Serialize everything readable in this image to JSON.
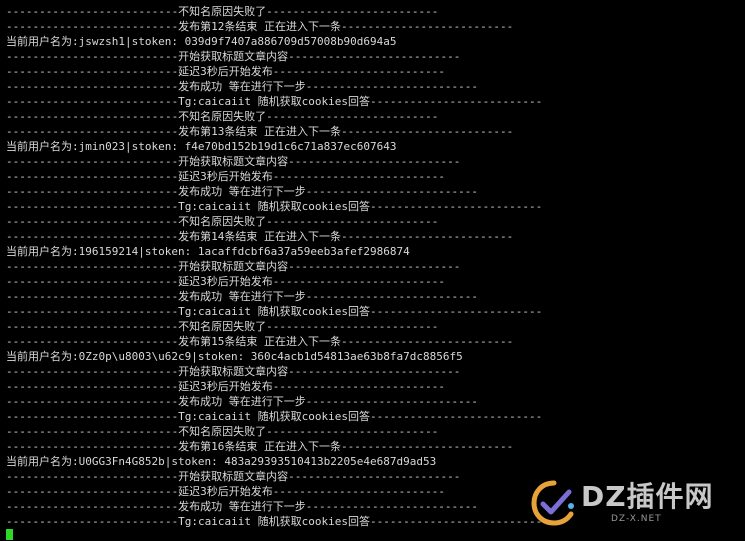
{
  "terminal": {
    "lines": [
      "--------------------------不知名原因失败了--------------------------",
      "--------------------------发布第12条结束 正在进入下一条--------------------------",
      "当前用户名为:jswzsh1|stoken: 039d9f7407a886709d57008b90d694a5",
      "--------------------------开始获取标题文章内容--------------------------",
      "--------------------------延迟3秒后开始发布--------------------------",
      "--------------------------发布成功 等在进行下一步--------------------------",
      "--------------------------Tg:caicaiit 随机获取cookies回答--------------------------",
      "--------------------------不知名原因失败了--------------------------",
      "--------------------------发布第13条结束 正在进入下一条--------------------------",
      "当前用户名为:jmin023|stoken: f4e70bd152b19d1c6c71a837ec607643",
      "--------------------------开始获取标题文章内容--------------------------",
      "--------------------------延迟3秒后开始发布--------------------------",
      "--------------------------发布成功 等在进行下一步--------------------------",
      "--------------------------Tg:caicaiit 随机获取cookies回答--------------------------",
      "--------------------------不知名原因失败了--------------------------",
      "--------------------------发布第14条结束 正在进入下一条--------------------------",
      "当前用户名为:196159214|stoken: 1acaffdcbf6a37a59eeb3afef2986874",
      "--------------------------开始获取标题文章内容--------------------------",
      "--------------------------延迟3秒后开始发布--------------------------",
      "--------------------------发布成功 等在进行下一步--------------------------",
      "--------------------------Tg:caicaiit 随机获取cookies回答--------------------------",
      "--------------------------不知名原因失败了--------------------------",
      "--------------------------发布第15条结束 正在进入下一条--------------------------",
      "当前用户名为:0Zz0p\\u8003\\u62c9|stoken: 360c4acb1d54813ae63b8fa7dc8856f5",
      "--------------------------开始获取标题文章内容--------------------------",
      "--------------------------延迟3秒后开始发布--------------------------",
      "--------------------------发布成功 等在进行下一步--------------------------",
      "--------------------------Tg:caicaiit 随机获取cookies回答--------------------------",
      "--------------------------不知名原因失败了--------------------------",
      "--------------------------发布第16条结束 正在进入下一条--------------------------",
      "当前用户名为:U0GG3Fn4G852b|stoken: 483a29393510413b2205e4e687d9ad53",
      "--------------------------开始获取标题文章内容--------------------------",
      "--------------------------延迟3秒后开始发布--------------------------",
      "--------------------------发布成功 等在进行下一步--------------------------",
      "--------------------------Tg:caicaiit 随机获取cookies回答--------------------------"
    ],
    "cursor_color": "#2bd82b",
    "background": "#000000",
    "text_color": "#d8d8d8"
  },
  "watermark": {
    "main_text": "DZ插件网",
    "sub_text": "DZ-X.NET",
    "icon": "dz-logo-icon"
  }
}
